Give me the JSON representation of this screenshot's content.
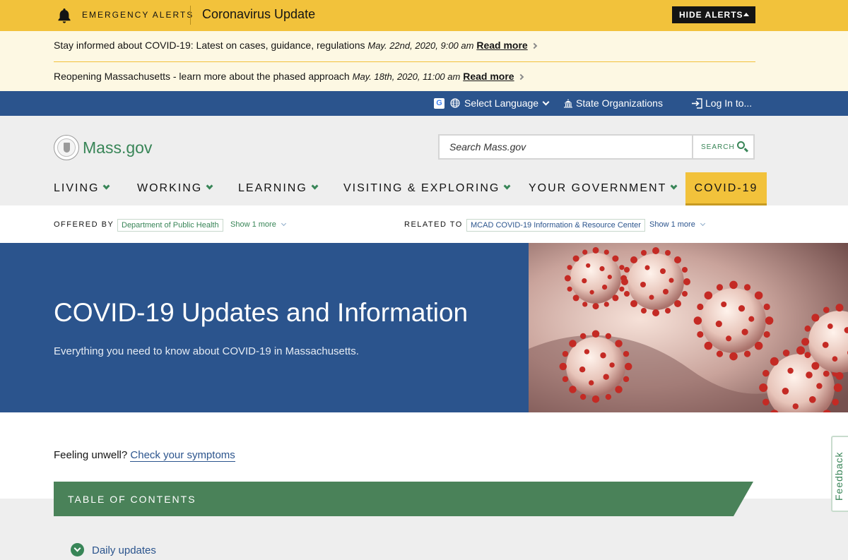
{
  "alerts": {
    "kicker": "EMERGENCY ALERTS",
    "title": "Coronavirus Update",
    "hide_label": "HIDE ALERTS",
    "items": [
      {
        "text": "Stay informed about COVID-19: Latest on cases, guidance, regulations",
        "date": "May. 22nd, 2020, 9:00 am",
        "link": "Read more"
      },
      {
        "text": "Reopening Massachusetts - learn more about the phased approach",
        "date": "May. 18th, 2020, 11:00 am",
        "link": "Read more"
      }
    ]
  },
  "utility_nav": {
    "language": "Select Language",
    "organizations": "State Organizations",
    "login": "Log In to..."
  },
  "header": {
    "logo_text": "Mass.gov",
    "search_placeholder": "Search Mass.gov",
    "search_button": "SEARCH"
  },
  "main_nav": [
    {
      "label": "LIVING"
    },
    {
      "label": "WORKING"
    },
    {
      "label": "LEARNING"
    },
    {
      "label": "VISITING & EXPLORING"
    },
    {
      "label": "YOUR GOVERNMENT"
    },
    {
      "label": "COVID-19"
    }
  ],
  "offered_by": {
    "kicker": "OFFERED BY",
    "tag": "Department of Public Health",
    "more": "Show 1 more"
  },
  "related_to": {
    "kicker": "RELATED TO",
    "tag": "MCAD COVID-19 Information & Resource Center",
    "more": "Show 1 more"
  },
  "hero": {
    "title": "COVID-19 Updates and Information",
    "subtitle": "Everything you need to know about COVID-19 in Massachusetts."
  },
  "body": {
    "unwell_text": "Feeling unwell?",
    "unwell_link": "Check your symptoms"
  },
  "toc": {
    "title": "TABLE OF CONTENTS",
    "items": [
      "Daily updates"
    ]
  },
  "feedback": "Feedback",
  "colors": {
    "alert_yellow": "#f2c23b",
    "alert_bg": "#fdf8e3",
    "brand_blue": "#2b548d",
    "brand_green": "#388557",
    "header_gray": "#eeeeee",
    "toc_green": "#4a8259"
  },
  "icons": [
    "bell-icon",
    "google-icon",
    "globe-icon",
    "capitol-icon",
    "login-icon",
    "search-icon",
    "chevron-down-icon",
    "chevron-right-icon"
  ]
}
